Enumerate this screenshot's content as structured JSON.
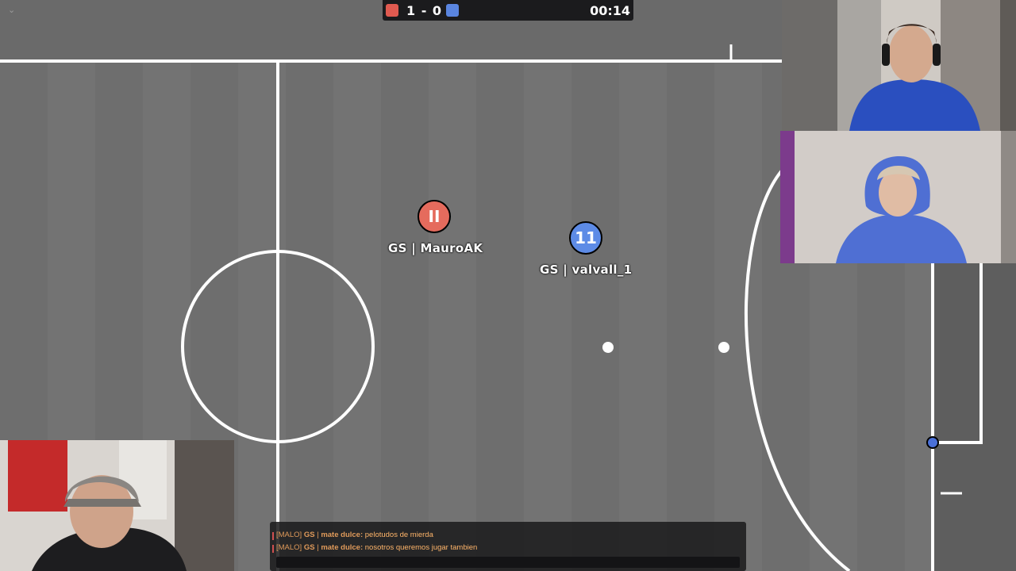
{
  "scoreboard": {
    "red_color": "#e05a50",
    "blue_color": "#5a85e0",
    "score": "1 - 0",
    "time": "00:14"
  },
  "collapse_icon": "⌄",
  "players": [
    {
      "number": "II",
      "name": "GS | MauroAK",
      "team": "red",
      "color": "#e56b5d"
    },
    {
      "number": "11",
      "name": "GS | valvall_1",
      "team": "blue",
      "color": "#5d8be6"
    }
  ],
  "chat": {
    "messages": [
      {
        "tag": "[MALO]",
        "clan": "GS",
        "user": "mate dulce:",
        "text": "pelotudos de mierda"
      },
      {
        "tag": "[MALO]",
        "clan": "GS",
        "user": "mate dulce:",
        "text": "nosotros queremos jugar tambien"
      }
    ],
    "input_value": ""
  },
  "webcams": [
    {
      "label": "streamer-cam-bottom-left"
    },
    {
      "label": "guest-cam-top-right"
    },
    {
      "label": "guest-cam-middle-right"
    }
  ]
}
